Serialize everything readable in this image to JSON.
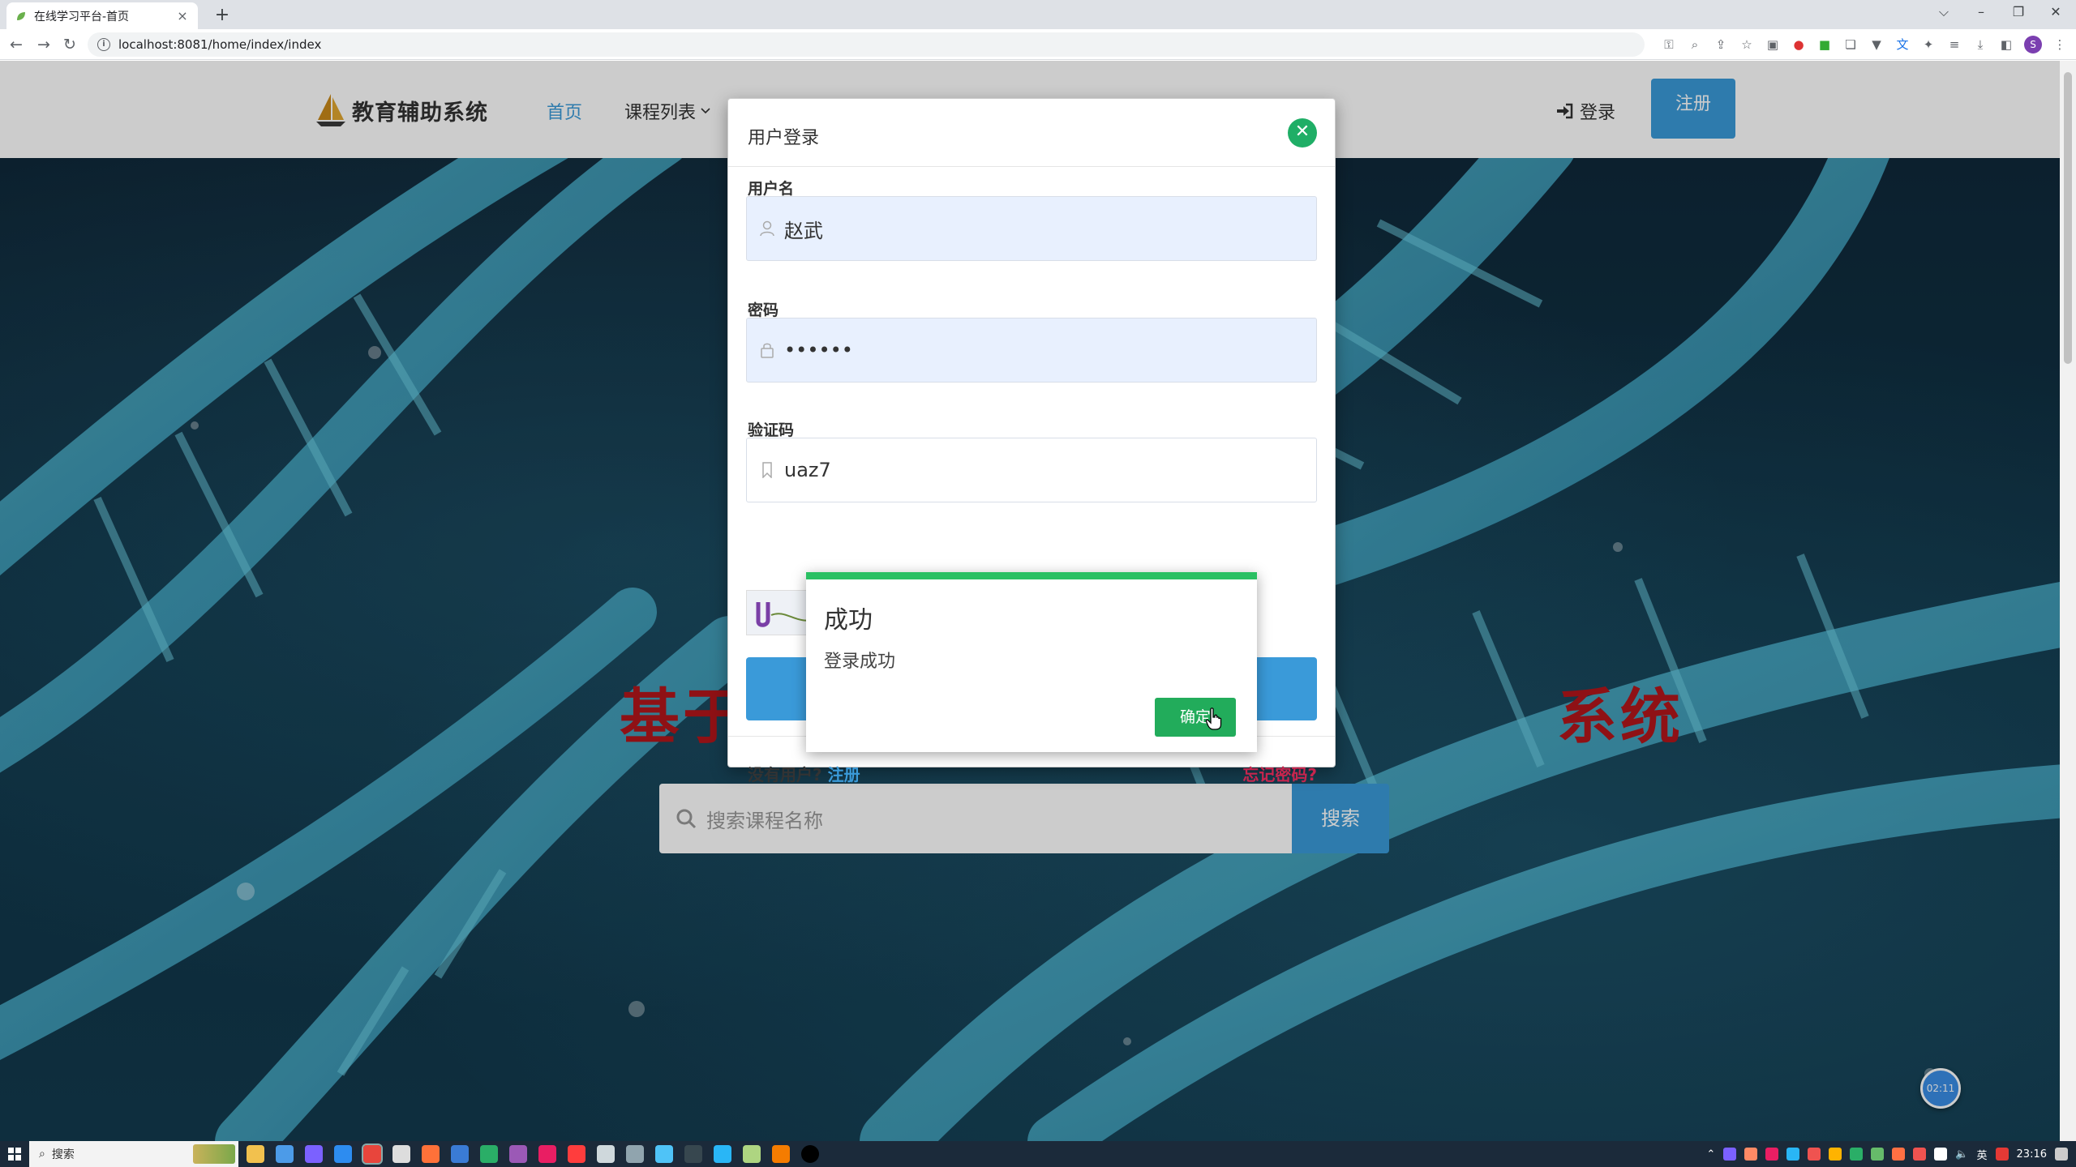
{
  "browser": {
    "tab_title": "在线学习平台-首页",
    "tab_close": "×",
    "new_tab": "+",
    "url": "localhost:8081/home/index/index",
    "window_controls": [
      "⌵",
      "–",
      "❐",
      "✕"
    ]
  },
  "header": {
    "logo_text": "教育辅助系统",
    "nav_home": "首页",
    "nav_courses": "课程列表",
    "nav_login": "登录",
    "nav_register": "注册"
  },
  "hero": {
    "title_left": "基于",
    "title_right": "系统",
    "search_placeholder": "搜索课程名称",
    "search_button": "搜索",
    "timer": "02:11"
  },
  "login_modal": {
    "title": "用户登录",
    "username_label": "用户名",
    "username_value": "赵武",
    "password_label": "密码",
    "password_value": "••••••",
    "captcha_label": "验证码",
    "captcha_value": "uaz7",
    "no_account_text": "没有用户?",
    "register_link": "注册",
    "forgot_link": "忘记密码?"
  },
  "success_dialog": {
    "title": "成功",
    "message": "登录成功",
    "ok_button": "确定"
  },
  "taskbar": {
    "search_text": "搜索",
    "time": "23:16",
    "ime": "英"
  },
  "colors": {
    "accent": "#3a9ad9",
    "success": "#2ac063",
    "hero_title": "#b3161b",
    "forgot": "#c7254e"
  }
}
